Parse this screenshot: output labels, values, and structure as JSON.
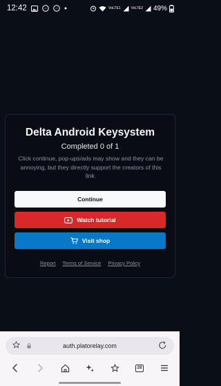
{
  "status": {
    "time": "12:42",
    "battery": "49%",
    "net1": "VoLTE1",
    "net2": "VoLTE2"
  },
  "card": {
    "title": "Delta Android Keysystem",
    "progress": "Completed 0 of 1",
    "description": "Click continue, pop-ups/ads may show and they can be annoying, but they directly support the creators of this link.",
    "continue_label": "Continue",
    "tutorial_label": "Watch tutorial",
    "shop_label": "Visit shop",
    "links": {
      "report": "Report",
      "terms": "Terms of Service",
      "privacy": "Privacy Policy"
    }
  },
  "browser": {
    "url": "auth.platorelay.com",
    "tab_count": "28"
  },
  "colors": {
    "background": "#0a0e17",
    "continue": "#f8f9fb",
    "tutorial": "#d82828",
    "shop": "#0a78c8"
  }
}
